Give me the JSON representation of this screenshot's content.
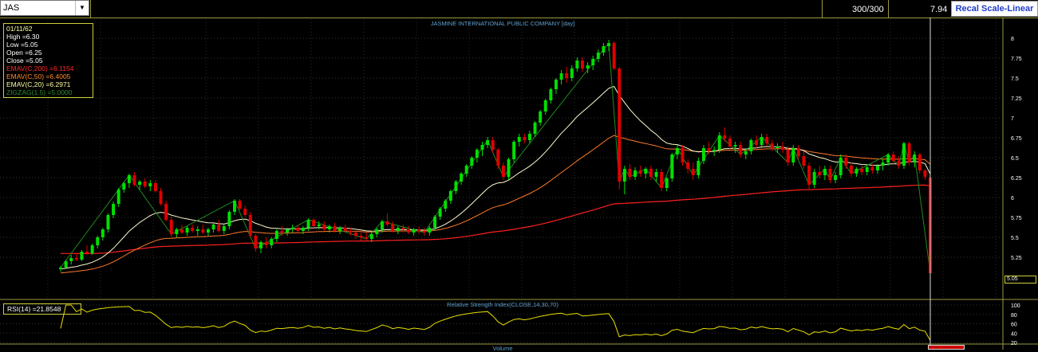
{
  "toolbar": {
    "symbol": "JAS",
    "count": "300/300",
    "price": "7.94",
    "recal_label": "Recal Scale-Linear",
    "dropdown_icon": "chevron-down-icon"
  },
  "info": {
    "date": "01/11/62",
    "high": "High  =6.30",
    "low": "Low  =5.05",
    "open": "Open  =6.25",
    "close": "Close  =5.05",
    "ema200": "EMAV(C,200)  =6.1154",
    "ema50": "EMAV(C,50)  =6.4005",
    "ema20": "EMAV(C,20)  =6.2971",
    "zigzag": "ZIGZAG(1.5)  =5.0000"
  },
  "rsi": {
    "label": "RSI(14)  =21.8548",
    "title": "Relative Strength Index(CLOSE,14,30,70)"
  },
  "volume_title": "Volume",
  "last_price_label": "5.05",
  "colors": {
    "up": "#00e000",
    "down": "#e00000",
    "ema200": "#ff2020",
    "ema50": "#ff7a2a",
    "ema20": "#fffbd0",
    "zigzag": "#208a20",
    "rsi": "#e8e000",
    "frame": "#9a9a40"
  },
  "chart_data": [
    {
      "type": "candlestick",
      "title": "JASMINE INTERNATIONAL PUBLIC COMPANY [day]",
      "ylim": [
        5.0,
        8.0
      ],
      "yticks": [
        "5.25",
        "5.5",
        "5.75",
        "6",
        "6.25",
        "6.5",
        "6.75",
        "7",
        "7.25",
        "7.5",
        "7.75",
        "8"
      ],
      "indicators": [
        "EMAV(C,200)",
        "EMAV(C,50)",
        "EMAV(C,20)",
        "ZIGZAG(1.5)"
      ],
      "candles": [
        {
          "o": 5.1,
          "h": 5.14,
          "l": 5.07,
          "c": 5.12
        },
        {
          "o": 5.12,
          "h": 5.22,
          "l": 5.1,
          "c": 5.2
        },
        {
          "o": 5.2,
          "h": 5.28,
          "l": 5.16,
          "c": 5.24
        },
        {
          "o": 5.24,
          "h": 5.3,
          "l": 5.2,
          "c": 5.22
        },
        {
          "o": 5.22,
          "h": 5.34,
          "l": 5.2,
          "c": 5.32
        },
        {
          "o": 5.32,
          "h": 5.4,
          "l": 5.28,
          "c": 5.3
        },
        {
          "o": 5.3,
          "h": 5.42,
          "l": 5.28,
          "c": 5.4
        },
        {
          "o": 5.4,
          "h": 5.52,
          "l": 5.36,
          "c": 5.5
        },
        {
          "o": 5.5,
          "h": 5.62,
          "l": 5.46,
          "c": 5.6
        },
        {
          "o": 5.6,
          "h": 5.8,
          "l": 5.56,
          "c": 5.78
        },
        {
          "o": 5.78,
          "h": 5.95,
          "l": 5.74,
          "c": 5.92
        },
        {
          "o": 5.92,
          "h": 6.12,
          "l": 5.88,
          "c": 6.1
        },
        {
          "o": 6.1,
          "h": 6.2,
          "l": 6.06,
          "c": 6.18
        },
        {
          "o": 6.18,
          "h": 6.3,
          "l": 6.12,
          "c": 6.28
        },
        {
          "o": 6.28,
          "h": 6.32,
          "l": 6.14,
          "c": 6.16
        },
        {
          "o": 6.16,
          "h": 6.22,
          "l": 6.1,
          "c": 6.2
        },
        {
          "o": 6.2,
          "h": 6.24,
          "l": 6.12,
          "c": 6.14
        },
        {
          "o": 6.14,
          "h": 6.22,
          "l": 6.08,
          "c": 6.18
        },
        {
          "o": 6.18,
          "h": 6.22,
          "l": 6.06,
          "c": 6.08
        },
        {
          "o": 6.08,
          "h": 6.12,
          "l": 5.9,
          "c": 5.92
        },
        {
          "o": 5.92,
          "h": 5.96,
          "l": 5.7,
          "c": 5.72
        },
        {
          "o": 5.72,
          "h": 5.76,
          "l": 5.5,
          "c": 5.54
        },
        {
          "o": 5.54,
          "h": 5.62,
          "l": 5.5,
          "c": 5.6
        },
        {
          "o": 5.6,
          "h": 5.66,
          "l": 5.54,
          "c": 5.56
        },
        {
          "o": 5.56,
          "h": 5.64,
          "l": 5.52,
          "c": 5.62
        },
        {
          "o": 5.62,
          "h": 5.66,
          "l": 5.56,
          "c": 5.58
        },
        {
          "o": 5.58,
          "h": 5.64,
          "l": 5.52,
          "c": 5.6
        },
        {
          "o": 5.6,
          "h": 5.66,
          "l": 5.54,
          "c": 5.56
        },
        {
          "o": 5.56,
          "h": 5.62,
          "l": 5.52,
          "c": 5.6
        },
        {
          "o": 5.6,
          "h": 5.68,
          "l": 5.56,
          "c": 5.66
        },
        {
          "o": 5.66,
          "h": 5.72,
          "l": 5.56,
          "c": 5.58
        },
        {
          "o": 5.58,
          "h": 5.66,
          "l": 5.54,
          "c": 5.64
        },
        {
          "o": 5.64,
          "h": 5.84,
          "l": 5.6,
          "c": 5.82
        },
        {
          "o": 5.82,
          "h": 5.98,
          "l": 5.78,
          "c": 5.96
        },
        {
          "o": 5.96,
          "h": 5.98,
          "l": 5.84,
          "c": 5.86
        },
        {
          "o": 5.86,
          "h": 5.9,
          "l": 5.76,
          "c": 5.78
        },
        {
          "o": 5.78,
          "h": 5.82,
          "l": 5.5,
          "c": 5.52
        },
        {
          "o": 5.52,
          "h": 5.54,
          "l": 5.32,
          "c": 5.36
        },
        {
          "o": 5.36,
          "h": 5.46,
          "l": 5.3,
          "c": 5.44
        },
        {
          "o": 5.44,
          "h": 5.5,
          "l": 5.36,
          "c": 5.4
        },
        {
          "o": 5.4,
          "h": 5.5,
          "l": 5.36,
          "c": 5.48
        },
        {
          "o": 5.48,
          "h": 5.6,
          "l": 5.44,
          "c": 5.58
        },
        {
          "o": 5.58,
          "h": 5.64,
          "l": 5.52,
          "c": 5.56
        },
        {
          "o": 5.56,
          "h": 5.62,
          "l": 5.52,
          "c": 5.6
        },
        {
          "o": 5.6,
          "h": 5.66,
          "l": 5.56,
          "c": 5.62
        },
        {
          "o": 5.62,
          "h": 5.66,
          "l": 5.56,
          "c": 5.58
        },
        {
          "o": 5.58,
          "h": 5.64,
          "l": 5.54,
          "c": 5.62
        },
        {
          "o": 5.62,
          "h": 5.74,
          "l": 5.58,
          "c": 5.72
        },
        {
          "o": 5.72,
          "h": 5.74,
          "l": 5.62,
          "c": 5.64
        },
        {
          "o": 5.64,
          "h": 5.7,
          "l": 5.6,
          "c": 5.66
        },
        {
          "o": 5.66,
          "h": 5.7,
          "l": 5.58,
          "c": 5.6
        },
        {
          "o": 5.6,
          "h": 5.66,
          "l": 5.56,
          "c": 5.64
        },
        {
          "o": 5.64,
          "h": 5.68,
          "l": 5.56,
          "c": 5.58
        },
        {
          "o": 5.58,
          "h": 5.64,
          "l": 5.54,
          "c": 5.62
        },
        {
          "o": 5.62,
          "h": 5.66,
          "l": 5.56,
          "c": 5.58
        },
        {
          "o": 5.58,
          "h": 5.62,
          "l": 5.52,
          "c": 5.56
        },
        {
          "o": 5.56,
          "h": 5.6,
          "l": 5.48,
          "c": 5.52
        },
        {
          "o": 5.52,
          "h": 5.56,
          "l": 5.46,
          "c": 5.5
        },
        {
          "o": 5.5,
          "h": 5.56,
          "l": 5.46,
          "c": 5.48
        },
        {
          "o": 5.48,
          "h": 5.56,
          "l": 5.44,
          "c": 5.54
        },
        {
          "o": 5.54,
          "h": 5.62,
          "l": 5.5,
          "c": 5.6
        },
        {
          "o": 5.6,
          "h": 5.72,
          "l": 5.56,
          "c": 5.7
        },
        {
          "o": 5.7,
          "h": 5.8,
          "l": 5.64,
          "c": 5.66
        },
        {
          "o": 5.66,
          "h": 5.7,
          "l": 5.56,
          "c": 5.58
        },
        {
          "o": 5.58,
          "h": 5.64,
          "l": 5.54,
          "c": 5.62
        },
        {
          "o": 5.62,
          "h": 5.66,
          "l": 5.56,
          "c": 5.6
        },
        {
          "o": 5.6,
          "h": 5.64,
          "l": 5.54,
          "c": 5.56
        },
        {
          "o": 5.56,
          "h": 5.62,
          "l": 5.52,
          "c": 5.6
        },
        {
          "o": 5.6,
          "h": 5.64,
          "l": 5.54,
          "c": 5.58
        },
        {
          "o": 5.58,
          "h": 5.62,
          "l": 5.52,
          "c": 5.56
        },
        {
          "o": 5.56,
          "h": 5.64,
          "l": 5.52,
          "c": 5.62
        },
        {
          "o": 5.62,
          "h": 5.78,
          "l": 5.58,
          "c": 5.76
        },
        {
          "o": 5.76,
          "h": 5.88,
          "l": 5.72,
          "c": 5.86
        },
        {
          "o": 5.86,
          "h": 5.98,
          "l": 5.82,
          "c": 5.96
        },
        {
          "o": 5.96,
          "h": 6.1,
          "l": 5.92,
          "c": 6.08
        },
        {
          "o": 6.08,
          "h": 6.22,
          "l": 6.04,
          "c": 6.2
        },
        {
          "o": 6.2,
          "h": 6.32,
          "l": 6.16,
          "c": 6.3
        },
        {
          "o": 6.3,
          "h": 6.42,
          "l": 6.26,
          "c": 6.4
        },
        {
          "o": 6.4,
          "h": 6.52,
          "l": 6.36,
          "c": 6.5
        },
        {
          "o": 6.5,
          "h": 6.62,
          "l": 6.44,
          "c": 6.6
        },
        {
          "o": 6.6,
          "h": 6.7,
          "l": 6.52,
          "c": 6.66
        },
        {
          "o": 6.66,
          "h": 6.76,
          "l": 6.62,
          "c": 6.72
        },
        {
          "o": 6.72,
          "h": 6.76,
          "l": 6.56,
          "c": 6.6
        },
        {
          "o": 6.6,
          "h": 6.62,
          "l": 6.36,
          "c": 6.4
        },
        {
          "o": 6.4,
          "h": 6.44,
          "l": 6.22,
          "c": 6.26
        },
        {
          "o": 6.26,
          "h": 6.5,
          "l": 6.22,
          "c": 6.48
        },
        {
          "o": 6.48,
          "h": 6.72,
          "l": 6.44,
          "c": 6.7
        },
        {
          "o": 6.7,
          "h": 6.8,
          "l": 6.64,
          "c": 6.76
        },
        {
          "o": 6.76,
          "h": 6.8,
          "l": 6.68,
          "c": 6.72
        },
        {
          "o": 6.72,
          "h": 6.84,
          "l": 6.68,
          "c": 6.8
        },
        {
          "o": 6.8,
          "h": 6.96,
          "l": 6.76,
          "c": 6.94
        },
        {
          "o": 6.94,
          "h": 7.1,
          "l": 6.9,
          "c": 7.08
        },
        {
          "o": 7.08,
          "h": 7.24,
          "l": 7.04,
          "c": 7.22
        },
        {
          "o": 7.22,
          "h": 7.38,
          "l": 7.18,
          "c": 7.36
        },
        {
          "o": 7.36,
          "h": 7.5,
          "l": 7.3,
          "c": 7.48
        },
        {
          "o": 7.48,
          "h": 7.6,
          "l": 7.42,
          "c": 7.56
        },
        {
          "o": 7.56,
          "h": 7.64,
          "l": 7.44,
          "c": 7.5
        },
        {
          "o": 7.5,
          "h": 7.66,
          "l": 7.46,
          "c": 7.62
        },
        {
          "o": 7.62,
          "h": 7.76,
          "l": 7.58,
          "c": 7.72
        },
        {
          "o": 7.72,
          "h": 7.76,
          "l": 7.58,
          "c": 7.62
        },
        {
          "o": 7.62,
          "h": 7.7,
          "l": 7.56,
          "c": 7.66
        },
        {
          "o": 7.66,
          "h": 7.78,
          "l": 7.6,
          "c": 7.74
        },
        {
          "o": 7.74,
          "h": 7.86,
          "l": 7.7,
          "c": 7.82
        },
        {
          "o": 7.82,
          "h": 7.94,
          "l": 7.78,
          "c": 7.9
        },
        {
          "o": 7.9,
          "h": 7.98,
          "l": 7.84,
          "c": 7.94
        },
        {
          "o": 7.94,
          "h": 7.96,
          "l": 7.6,
          "c": 7.62
        },
        {
          "o": 7.62,
          "h": 7.64,
          "l": 6.1,
          "c": 6.2
        },
        {
          "o": 6.2,
          "h": 6.4,
          "l": 6.04,
          "c": 6.36
        },
        {
          "o": 6.36,
          "h": 6.42,
          "l": 6.22,
          "c": 6.26
        },
        {
          "o": 6.26,
          "h": 6.38,
          "l": 6.22,
          "c": 6.34
        },
        {
          "o": 6.34,
          "h": 6.4,
          "l": 6.26,
          "c": 6.3
        },
        {
          "o": 6.3,
          "h": 6.38,
          "l": 6.24,
          "c": 6.36
        },
        {
          "o": 6.36,
          "h": 6.4,
          "l": 6.22,
          "c": 6.26
        },
        {
          "o": 6.26,
          "h": 6.36,
          "l": 6.2,
          "c": 6.32
        },
        {
          "o": 6.32,
          "h": 6.36,
          "l": 6.08,
          "c": 6.12
        },
        {
          "o": 6.12,
          "h": 6.26,
          "l": 6.08,
          "c": 6.24
        },
        {
          "o": 6.24,
          "h": 6.56,
          "l": 6.2,
          "c": 6.54
        },
        {
          "o": 6.54,
          "h": 6.66,
          "l": 6.48,
          "c": 6.62
        },
        {
          "o": 6.62,
          "h": 6.66,
          "l": 6.4,
          "c": 6.44
        },
        {
          "o": 6.44,
          "h": 6.48,
          "l": 6.3,
          "c": 6.36
        },
        {
          "o": 6.36,
          "h": 6.44,
          "l": 6.22,
          "c": 6.28
        },
        {
          "o": 6.28,
          "h": 6.5,
          "l": 6.24,
          "c": 6.46
        },
        {
          "o": 6.46,
          "h": 6.66,
          "l": 6.42,
          "c": 6.62
        },
        {
          "o": 6.62,
          "h": 6.7,
          "l": 6.54,
          "c": 6.58
        },
        {
          "o": 6.58,
          "h": 6.64,
          "l": 6.52,
          "c": 6.6
        },
        {
          "o": 6.6,
          "h": 6.82,
          "l": 6.56,
          "c": 6.78
        },
        {
          "o": 6.78,
          "h": 6.88,
          "l": 6.7,
          "c": 6.74
        },
        {
          "o": 6.74,
          "h": 6.78,
          "l": 6.6,
          "c": 6.64
        },
        {
          "o": 6.64,
          "h": 6.7,
          "l": 6.56,
          "c": 6.66
        },
        {
          "o": 6.66,
          "h": 6.7,
          "l": 6.5,
          "c": 6.54
        },
        {
          "o": 6.54,
          "h": 6.62,
          "l": 6.48,
          "c": 6.58
        },
        {
          "o": 6.58,
          "h": 6.74,
          "l": 6.54,
          "c": 6.72
        },
        {
          "o": 6.72,
          "h": 6.78,
          "l": 6.62,
          "c": 6.66
        },
        {
          "o": 6.66,
          "h": 6.8,
          "l": 6.62,
          "c": 6.76
        },
        {
          "o": 6.76,
          "h": 6.8,
          "l": 6.64,
          "c": 6.68
        },
        {
          "o": 6.68,
          "h": 6.72,
          "l": 6.58,
          "c": 6.62
        },
        {
          "o": 6.62,
          "h": 6.68,
          "l": 6.56,
          "c": 6.64
        },
        {
          "o": 6.64,
          "h": 6.7,
          "l": 6.56,
          "c": 6.6
        },
        {
          "o": 6.6,
          "h": 6.64,
          "l": 6.4,
          "c": 6.44
        },
        {
          "o": 6.44,
          "h": 6.66,
          "l": 6.4,
          "c": 6.62
        },
        {
          "o": 6.62,
          "h": 6.66,
          "l": 6.48,
          "c": 6.52
        },
        {
          "o": 6.52,
          "h": 6.58,
          "l": 6.36,
          "c": 6.4
        },
        {
          "o": 6.4,
          "h": 6.44,
          "l": 6.1,
          "c": 6.16
        },
        {
          "o": 6.16,
          "h": 6.36,
          "l": 6.12,
          "c": 6.32
        },
        {
          "o": 6.32,
          "h": 6.4,
          "l": 6.24,
          "c": 6.28
        },
        {
          "o": 6.28,
          "h": 6.4,
          "l": 6.22,
          "c": 6.36
        },
        {
          "o": 6.36,
          "h": 6.4,
          "l": 6.18,
          "c": 6.22
        },
        {
          "o": 6.22,
          "h": 6.32,
          "l": 6.18,
          "c": 6.28
        },
        {
          "o": 6.28,
          "h": 6.54,
          "l": 6.24,
          "c": 6.5
        },
        {
          "o": 6.5,
          "h": 6.54,
          "l": 6.36,
          "c": 6.4
        },
        {
          "o": 6.4,
          "h": 6.44,
          "l": 6.26,
          "c": 6.3
        },
        {
          "o": 6.3,
          "h": 6.38,
          "l": 6.26,
          "c": 6.36
        },
        {
          "o": 6.36,
          "h": 6.4,
          "l": 6.28,
          "c": 6.32
        },
        {
          "o": 6.32,
          "h": 6.42,
          "l": 6.28,
          "c": 6.38
        },
        {
          "o": 6.38,
          "h": 6.42,
          "l": 6.3,
          "c": 6.34
        },
        {
          "o": 6.34,
          "h": 6.42,
          "l": 6.3,
          "c": 6.4
        },
        {
          "o": 6.4,
          "h": 6.48,
          "l": 6.34,
          "c": 6.44
        },
        {
          "o": 6.44,
          "h": 6.56,
          "l": 6.4,
          "c": 6.54
        },
        {
          "o": 6.54,
          "h": 6.58,
          "l": 6.42,
          "c": 6.46
        },
        {
          "o": 6.46,
          "h": 6.52,
          "l": 6.36,
          "c": 6.4
        },
        {
          "o": 6.4,
          "h": 6.7,
          "l": 6.36,
          "c": 6.68
        },
        {
          "o": 6.68,
          "h": 6.7,
          "l": 6.4,
          "c": 6.44
        },
        {
          "o": 6.44,
          "h": 6.58,
          "l": 6.38,
          "c": 6.54
        },
        {
          "o": 6.54,
          "h": 6.56,
          "l": 6.3,
          "c": 6.34
        },
        {
          "o": 6.34,
          "h": 6.36,
          "l": 6.22,
          "c": 6.26
        },
        {
          "o": 6.25,
          "h": 6.3,
          "l": 5.05,
          "c": 5.05
        }
      ]
    },
    {
      "type": "line",
      "title": "Relative Strength Index(CLOSE,14,30,70)",
      "ylim": [
        20,
        100
      ],
      "yticks": [
        "20",
        "40",
        "60",
        "80",
        "100"
      ]
    },
    {
      "type": "bar",
      "title": "Volume"
    }
  ]
}
